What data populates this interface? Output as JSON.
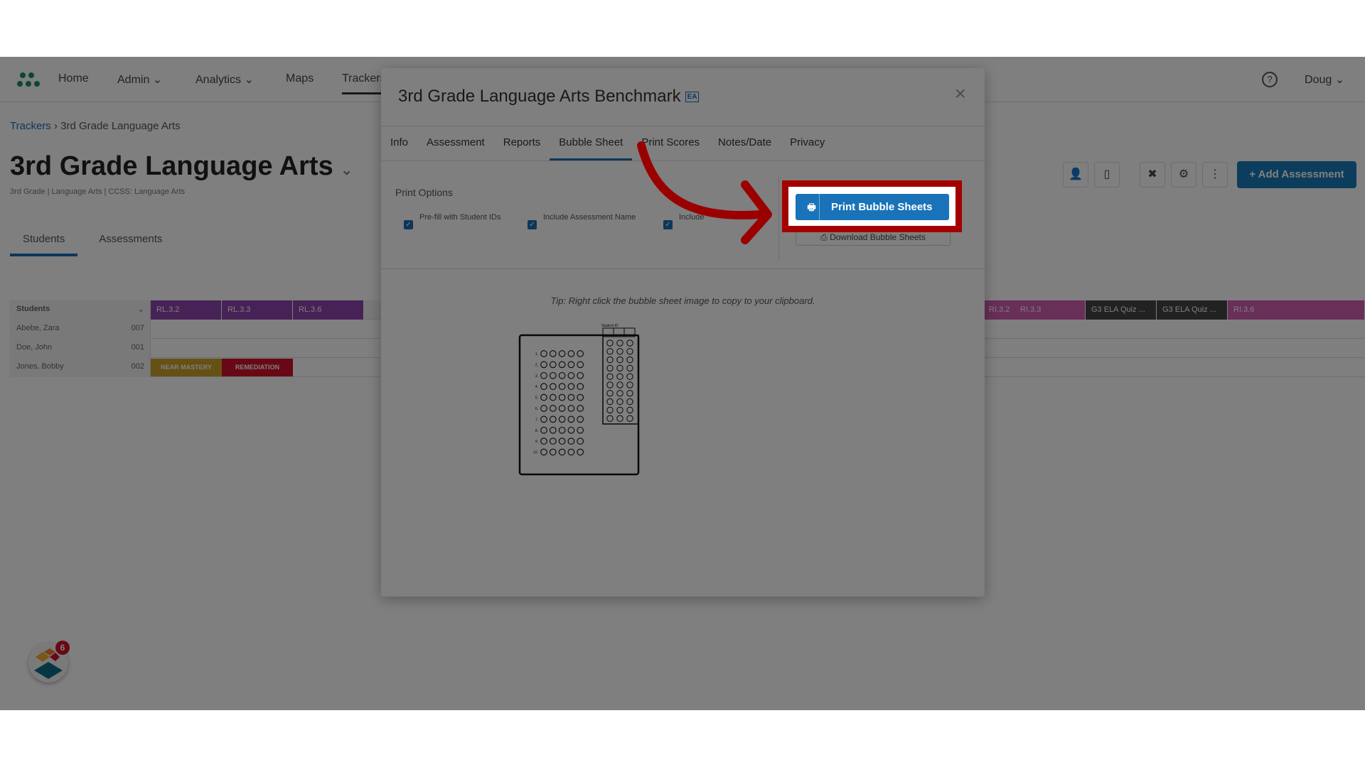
{
  "nav": {
    "items": [
      "Home",
      "Admin",
      "Analytics",
      "Maps",
      "Trackers"
    ],
    "user": "Doug"
  },
  "breadcrumb": {
    "root": "Trackers",
    "current": "3rd Grade Language Arts"
  },
  "page": {
    "title": "3rd Grade Language Arts",
    "subtitle": "3rd Grade | Language Arts | CCSS: Language Arts",
    "tabs": [
      "Students",
      "Assessments"
    ],
    "add_button": "Add Assessment"
  },
  "grid": {
    "header": "Students",
    "columns": [
      "RL.3.2",
      "RL.3.3",
      "RL.3.6",
      "RI.3.2",
      "RI.3.3",
      "G3 ELA Quiz ...",
      "G3 ELA Quiz ...",
      "RI.3.6"
    ],
    "rows": [
      {
        "name": "Abebe, Zara",
        "id": "007"
      },
      {
        "name": "Doe, John",
        "id": "001"
      },
      {
        "name": "Jones, Bobby",
        "id": "002"
      }
    ],
    "tags": [
      "NEAR MASTERY",
      "REMEDIATION"
    ]
  },
  "widget": {
    "badge": "6"
  },
  "modal": {
    "title": "3rd Grade Language Arts Benchmark",
    "badge": "EA",
    "close": "×",
    "tabs": [
      "Info",
      "Assessment",
      "Reports",
      "Bubble Sheet",
      "Print Scores",
      "Notes/Date",
      "Privacy"
    ],
    "active_tab": "Bubble Sheet",
    "print_options_label": "Print Options",
    "options": [
      {
        "label": "Pre-fill with Student IDs",
        "checked": true
      },
      {
        "label": "Include Assessment Name",
        "checked": true
      },
      {
        "label": "Include",
        "checked": true
      }
    ],
    "print_button": "Print Bubble Sheets",
    "download_button": "Download Bubble Sheets",
    "tip": "Tip: Right click the bubble sheet image to copy to your clipboard.",
    "sheet": {
      "id_label": "Student ID",
      "questions": [
        "1.",
        "2.",
        "3.",
        "4.",
        "5.",
        "6.",
        "7.",
        "8.",
        "9.",
        "10."
      ],
      "choices": [
        "A",
        "B",
        "C",
        "D",
        "E"
      ],
      "digits": [
        "0",
        "1",
        "2",
        "3",
        "4",
        "5",
        "6",
        "7",
        "8",
        "9"
      ]
    }
  },
  "colors": {
    "accent": "#1a73b8",
    "highlight": "#a30000",
    "purple": "#8e44ad",
    "pink": "#d05fb0"
  }
}
